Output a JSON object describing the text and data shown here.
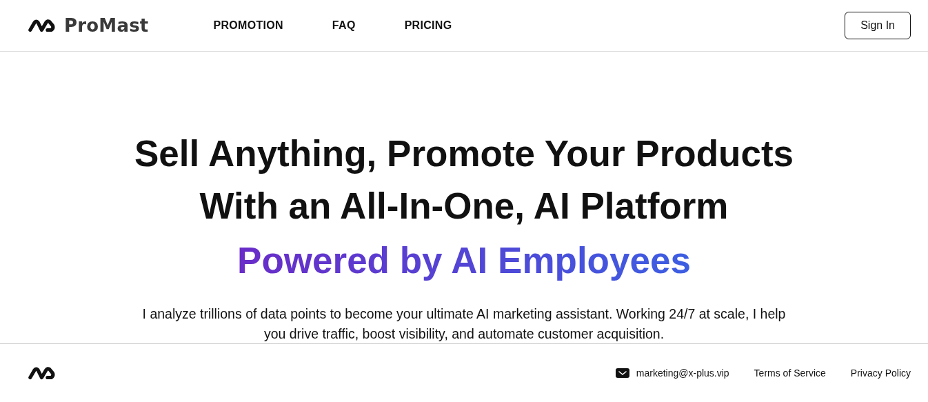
{
  "header": {
    "brand": "ProMast",
    "nav": [
      {
        "label": "PROMOTION"
      },
      {
        "label": "FAQ"
      },
      {
        "label": "PRICING"
      }
    ],
    "sign_in": "Sign In"
  },
  "hero": {
    "headline": [
      "Sell Anything, Promote Your Products",
      "With an All-In-One, AI Platform"
    ],
    "highlight": "Powered by AI Employees",
    "description": "I analyze trillions of data points to become your ultimate AI marketing assistant. Working 24/7 at scale, I help you drive traffic, boost visibility, and automate customer acquisition."
  },
  "footer": {
    "email": "marketing@x-plus.vip",
    "links": [
      {
        "label": "Terms of Service"
      },
      {
        "label": "Privacy Policy"
      }
    ]
  }
}
